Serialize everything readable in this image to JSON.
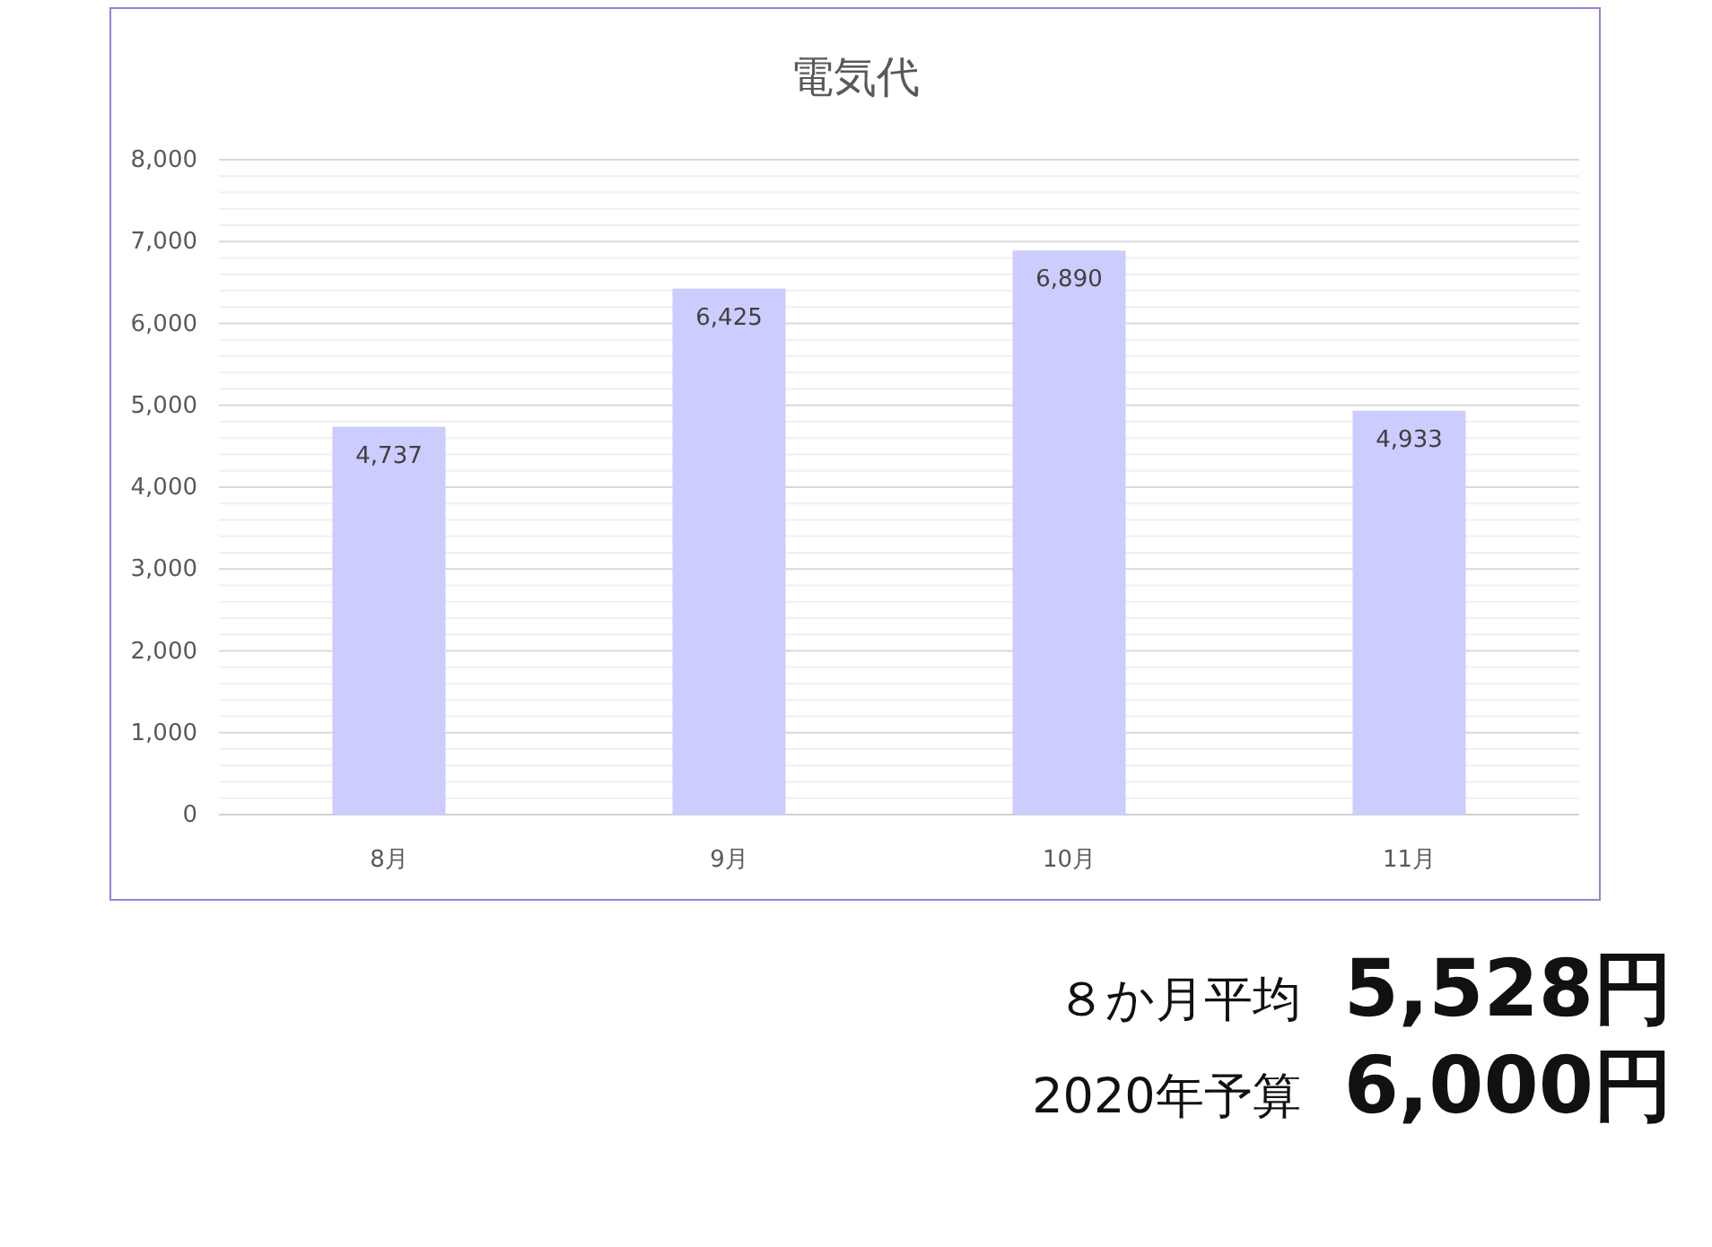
{
  "chart_data": {
    "type": "bar",
    "title": "電気代",
    "categories": [
      "8月",
      "9月",
      "10月",
      "11月"
    ],
    "values": [
      4737,
      6425,
      6890,
      4933
    ],
    "value_labels": [
      "4,737",
      "6,425",
      "6,890",
      "4,933"
    ],
    "color": "#ccccff",
    "ylim": [
      0,
      8000
    ],
    "yticks": [
      {
        "value": 0,
        "label": "0"
      },
      {
        "value": 1000,
        "label": "1,000"
      },
      {
        "value": 2000,
        "label": "2,000"
      },
      {
        "value": 3000,
        "label": "3,000"
      },
      {
        "value": 4000,
        "label": "4,000"
      },
      {
        "value": 5000,
        "label": "5,000"
      },
      {
        "value": 6000,
        "label": "6,000"
      },
      {
        "value": 7000,
        "label": "7,000"
      },
      {
        "value": 8000,
        "label": "8,000"
      }
    ],
    "data_labels": true,
    "grid": true
  },
  "summary": [
    {
      "label": "８か月平均",
      "value": "5,528円"
    },
    {
      "label": "2020年予算",
      "value": "6,000円"
    }
  ]
}
